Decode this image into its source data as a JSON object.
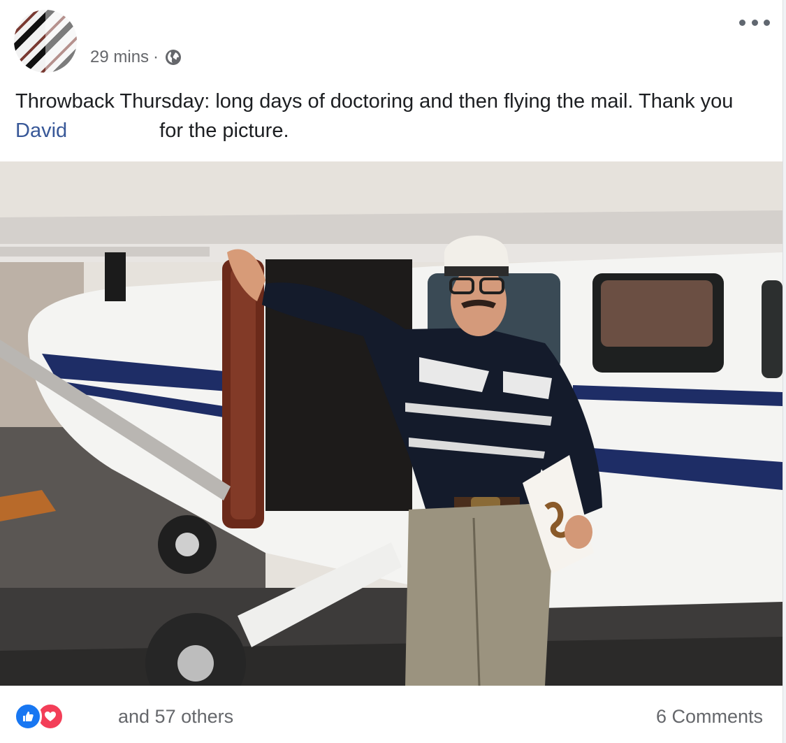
{
  "post": {
    "author_name": "",
    "timestamp": "29 mins",
    "separator": "·",
    "privacy_icon": "globe-icon",
    "more_icon": "more-options-icon",
    "text_before": "Throwback Thursday: long days of doctoring and then flying the mail. Thank you ",
    "mention": "David",
    "text_after": "for the picture.",
    "photo_icon": "photo-man-with-airplane"
  },
  "footer": {
    "reaction_icons": [
      "like-icon",
      "love-icon"
    ],
    "reactors_text": "and 57 others",
    "comments_text": "6 Comments"
  },
  "colors": {
    "link": "#385898",
    "meta_text": "#65676b",
    "like": "#1877f2",
    "love": "#f33e58"
  }
}
